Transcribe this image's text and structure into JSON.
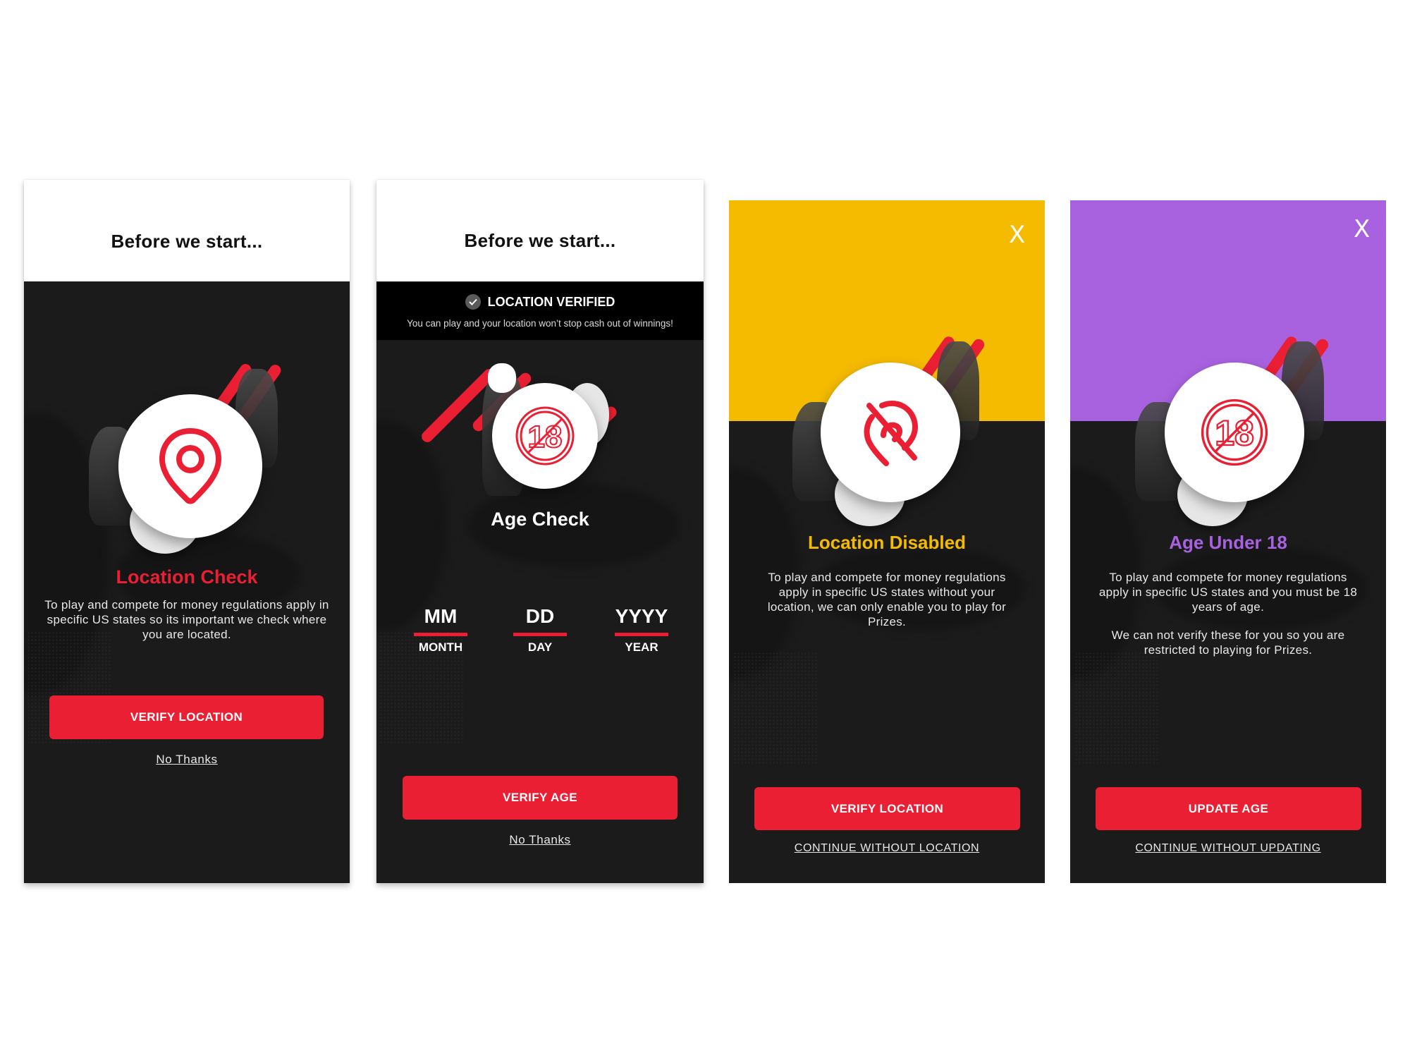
{
  "colors": {
    "brand_red": "#ea1f33",
    "dark_bg": "#1b1b1c",
    "warning_yellow": "#f5bb00",
    "restricted_purple": "#a862e0"
  },
  "screens": [
    {
      "id": "location-check",
      "header_title": "Before we start...",
      "icon": "location-pin-icon",
      "title": "Location Check",
      "body": "To play and compete for money regulations apply in specific US states so its important we check where you are located.",
      "primary_button": "VERIFY LOCATION",
      "secondary_link": "No Thanks"
    },
    {
      "id": "age-check",
      "header_title": "Before we start...",
      "banner": {
        "icon": "check-circle-icon",
        "title": "LOCATION VERIFIED",
        "subtitle": "You can play and your location won’t stop cash out of winnings!"
      },
      "icon": "no-under-18-icon",
      "title": "Age Check",
      "dob_fields": [
        {
          "placeholder": "MM",
          "label": "MONTH"
        },
        {
          "placeholder": "DD",
          "label": "DAY"
        },
        {
          "placeholder": "YYYY",
          "label": "YEAR"
        }
      ],
      "primary_button": "VERIFY AGE",
      "secondary_link": "No Thanks"
    },
    {
      "id": "location-disabled",
      "close_label": "X",
      "icon": "location-off-icon",
      "title": "Location Disabled",
      "body": "To play and compete for money regulations apply in specific US states without your location, we can only enable you to play for Prizes.",
      "primary_button": "VERIFY LOCATION",
      "secondary_link": "CONTINUE WITHOUT LOCATION"
    },
    {
      "id": "age-under-18",
      "close_label": "X",
      "icon": "no-under-18-icon",
      "title": "Age Under 18",
      "body": "To play and compete for money regulations apply in specific US states and you must be 18 years of age.",
      "body2": "We can not verify these for you so you are restricted to playing for Prizes.",
      "primary_button": "UPDATE AGE",
      "secondary_link": "CONTINUE WITHOUT UPDATING"
    }
  ]
}
